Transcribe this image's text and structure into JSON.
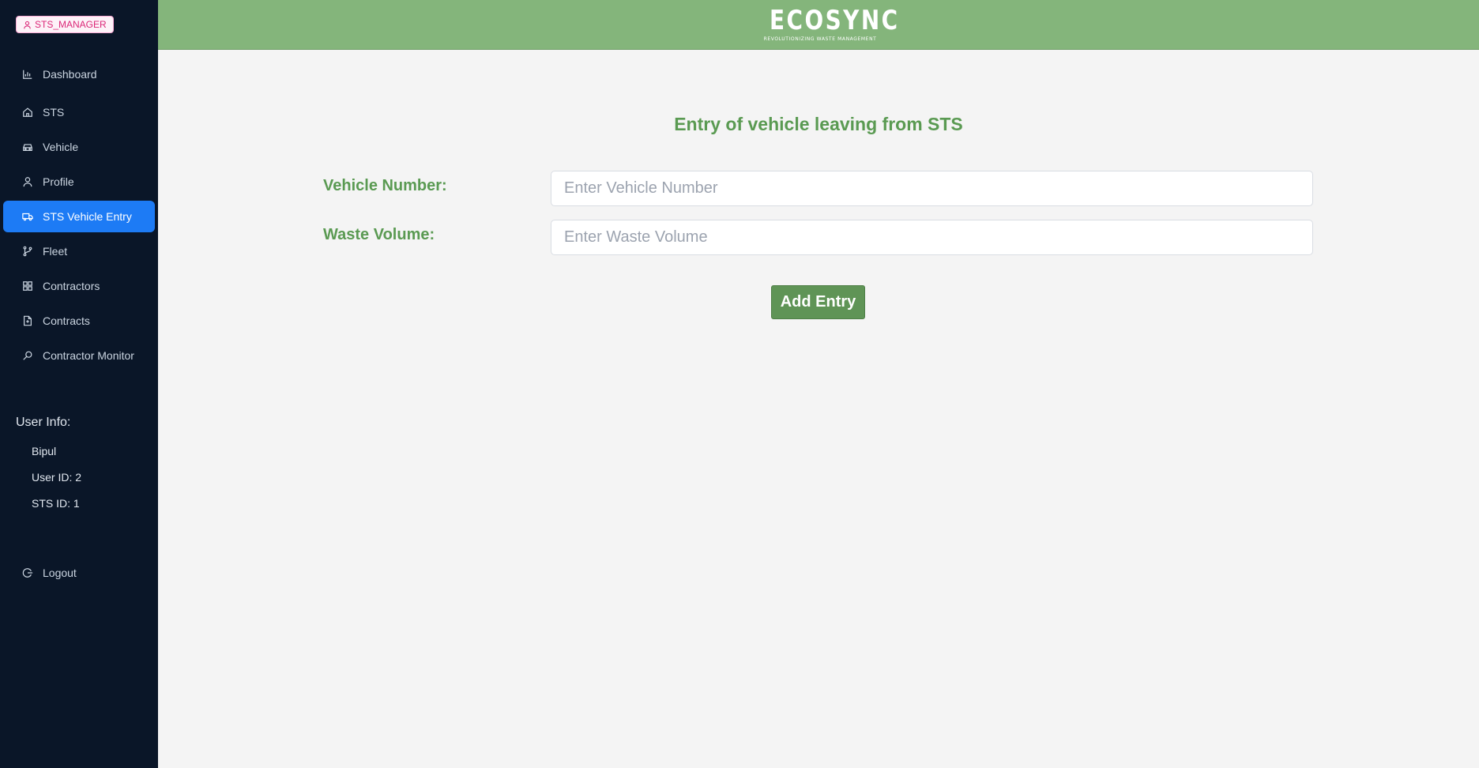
{
  "role_badge": "STS_MANAGER",
  "sidebar": {
    "items": [
      {
        "label": "Dashboard",
        "icon": "bar-chart-icon"
      },
      {
        "label": "STS",
        "icon": "home-icon"
      },
      {
        "label": "Vehicle",
        "icon": "car-icon"
      },
      {
        "label": "Profile",
        "icon": "user-icon"
      },
      {
        "label": "STS Vehicle Entry",
        "icon": "truck-icon",
        "active": true
      },
      {
        "label": "Fleet",
        "icon": "branch-icon"
      },
      {
        "label": "Contractors",
        "icon": "grid-icon"
      },
      {
        "label": "Contracts",
        "icon": "file-icon"
      },
      {
        "label": "Contractor Monitor",
        "icon": "search-icon"
      }
    ],
    "user_info": {
      "title": "User Info:",
      "name": "Bipul",
      "user_id": "User ID: 2",
      "sts_id": "STS ID: 1"
    },
    "logout": {
      "label": "Logout",
      "icon": "logout-icon"
    }
  },
  "header": {
    "logo_text": "ECOSYNC",
    "logo_tagline": "REVOLUTIONIZING WASTE MANAGEMENT"
  },
  "form": {
    "title": "Entry of vehicle leaving from STS",
    "vehicle_label": "Vehicle Number:",
    "vehicle_placeholder": "Enter Vehicle Number",
    "vehicle_value": "",
    "volume_label": "Waste Volume:",
    "volume_placeholder": "Enter Waste Volume",
    "volume_value": "",
    "submit_label": "Add Entry"
  },
  "colors": {
    "header_bg": "#84b57b",
    "sidebar_bg": "#0a1628",
    "active_item": "#1d7bf5",
    "accent_green": "#5a9a52",
    "button_bg": "#5f9456"
  }
}
